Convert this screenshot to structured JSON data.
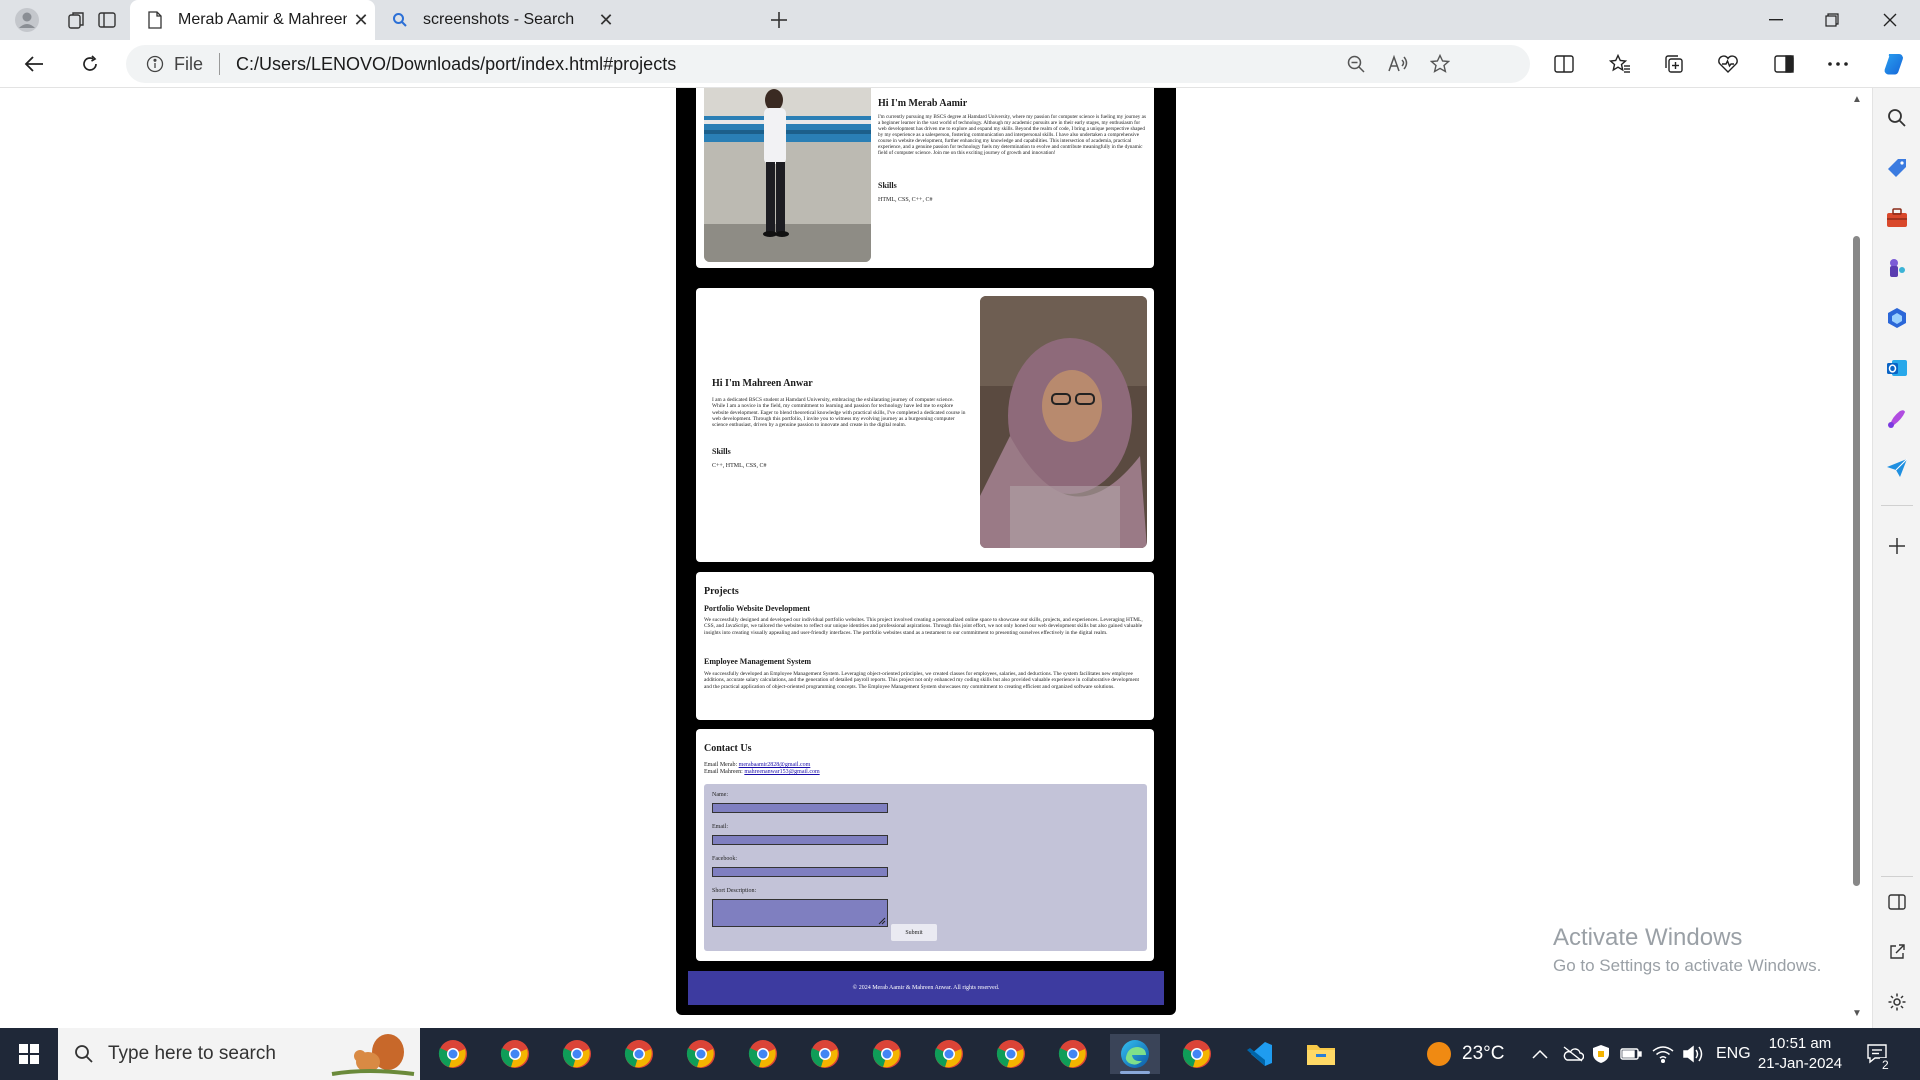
{
  "browser": {
    "tabs": [
      {
        "title": "Merab Aamir & Mahreen Anwar",
        "active": true
      },
      {
        "title": "screenshots - Search",
        "active": false
      }
    ],
    "address": {
      "scheme_label": "File",
      "url": "C:/Users/LENOVO/Downloads/port/index.html#projects"
    }
  },
  "page": {
    "merab": {
      "heading": "Hi I'm Merab Aamir",
      "bio": "I'm currently pursuing my BSCS degree at Hamdard University, where my passion for computer science is fueling my journey as a beginner learner in the vast world of technology. Although my academic pursuits are in their early stages, my enthusiasm for web development has driven me to explore and expand my skills. Beyond the realm of code, I bring a unique perspective shaped by my experience as a salesperson, fostering communication and interpersonal skills. I have also undertaken a comprehensive course in website development, further enhancing my knowledge and capabilities. This intersection of academia, practical experience, and a genuine passion for technology fuels my determination to evolve and contribute meaningfully in the dynamic field of computer science. Join me on this exciting journey of growth and innovation!",
      "skills_heading": "Skills",
      "skills": "HTML, CSS, C++, C#"
    },
    "mahreen": {
      "heading": "Hi I'm Mahreen Anwar",
      "bio": "I am a dedicated BSCS student at Hamdard University, embracing the exhilarating journey of computer science. While I am a novice in the field, my commitment to learning and passion for technology have led me to explore website development. Eager to blend theoretical knowledge with practical skills, I've completed a dedicated course in web development. Through this portfolio, I invite you to witness my evolving journey as a burgeoning computer science enthusiast, driven by a genuine passion to innovate and create in the digital realm.",
      "skills_heading": "Skills",
      "skills": "C++, HTML, CSS, C#"
    },
    "projects": {
      "heading": "Projects",
      "items": [
        {
          "title": "Portfolio Website Development",
          "desc": "We successfully designed and developed our individual portfolio websites. This project involved creating a personalized online space to showcase our skills, projects, and experiences. Leveraging HTML, CSS, and JavaScript, we tailored the websites to reflect our unique identities and professional aspirations. Through this joint effort, we not only honed our web development skills but also gained valuable insights into creating visually appealing and user-friendly interfaces. The portfolio websites stand as a testament to our commitment to presenting ourselves effectively in the digital realm."
        },
        {
          "title": "Employee Management System",
          "desc": "We successfully developed an Employee Management System. Leveraging object-oriented principles, we created classes for employees, salaries, and deductions. The system facilitates new employee additions, accurate salary calculations, and the generation of detailed payroll reports. This project not only enhanced my coding skills but also provided valuable experience in collaborative development and the practical application of object-oriented programming concepts. The Employee Management System showcases my commitment to creating efficient and organized software solutions."
        }
      ]
    },
    "contact": {
      "heading": "Contact Us",
      "merab_label": "Email Merab:",
      "merab_email": "merabaamir2828@gmail.com",
      "mahreen_label": "Email Mahreen:",
      "mahreen_email": "mahreenanwar153@gmail.com",
      "form": {
        "name_label": "Name:",
        "email_label": "Email:",
        "facebook_label": "Facebook:",
        "desc_label": "Short Description:",
        "submit_label": "Submit"
      }
    },
    "footer": "© 2024 Merab Aamir & Mahreen Anwar. All rights reserved."
  },
  "watermark": {
    "line1": "Activate Windows",
    "line2": "Go to Settings to activate Windows."
  },
  "taskbar": {
    "search_placeholder": "Type here to search",
    "temperature": "23°C",
    "language": "ENG",
    "time": "10:51 am",
    "date": "21-Jan-2024",
    "notification_count": "2"
  },
  "colors": {
    "accent_purple": "#3d3ba0",
    "input_fill": "#7f7fc0",
    "form_bg": "#c3c3d8"
  }
}
